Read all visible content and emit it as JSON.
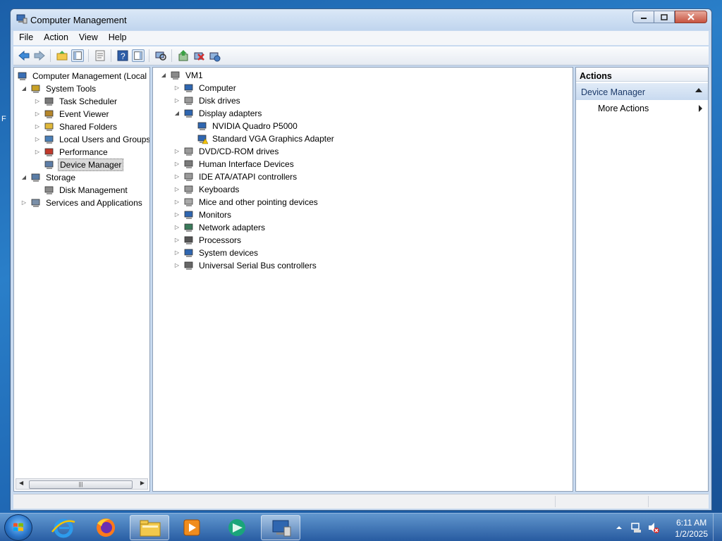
{
  "window": {
    "title": "Computer Management"
  },
  "menu": [
    "File",
    "Action",
    "View",
    "Help"
  ],
  "left_tree": [
    {
      "label": "Computer Management (Local",
      "icon": "computer-management-icon",
      "expander": "",
      "indent": 0
    },
    {
      "label": "System Tools",
      "icon": "system-tools-icon",
      "expander": "expanded",
      "indent": 1
    },
    {
      "label": "Task Scheduler",
      "icon": "clock-icon",
      "expander": "collapsed",
      "indent": 2
    },
    {
      "label": "Event Viewer",
      "icon": "event-viewer-icon",
      "expander": "collapsed",
      "indent": 2
    },
    {
      "label": "Shared Folders",
      "icon": "shared-folders-icon",
      "expander": "collapsed",
      "indent": 2
    },
    {
      "label": "Local Users and Groups",
      "icon": "users-icon",
      "expander": "collapsed",
      "indent": 2
    },
    {
      "label": "Performance",
      "icon": "performance-icon",
      "expander": "collapsed",
      "indent": 2
    },
    {
      "label": "Device Manager",
      "icon": "device-manager-icon",
      "expander": "",
      "indent": 2,
      "selected": true
    },
    {
      "label": "Storage",
      "icon": "storage-icon",
      "expander": "expanded",
      "indent": 1
    },
    {
      "label": "Disk Management",
      "icon": "disk-management-icon",
      "expander": "",
      "indent": 2
    },
    {
      "label": "Services and Applications",
      "icon": "services-icon",
      "expander": "collapsed",
      "indent": 1
    }
  ],
  "device_tree": [
    {
      "label": "VM1",
      "icon": "computer-icon",
      "expander": "expanded",
      "indent": 0
    },
    {
      "label": "Computer",
      "icon": "monitor-icon",
      "expander": "collapsed",
      "indent": 1
    },
    {
      "label": "Disk drives",
      "icon": "disk-drive-icon",
      "expander": "collapsed",
      "indent": 1
    },
    {
      "label": "Display adapters",
      "icon": "display-adapter-icon",
      "expander": "expanded",
      "indent": 1
    },
    {
      "label": "NVIDIA Quadro P5000",
      "icon": "display-adapter-icon",
      "expander": "",
      "indent": 2
    },
    {
      "label": "Standard VGA Graphics Adapter",
      "icon": "display-adapter-warning-icon",
      "expander": "",
      "indent": 2
    },
    {
      "label": "DVD/CD-ROM drives",
      "icon": "dvd-drive-icon",
      "expander": "collapsed",
      "indent": 1
    },
    {
      "label": "Human Interface Devices",
      "icon": "hid-icon",
      "expander": "collapsed",
      "indent": 1
    },
    {
      "label": "IDE ATA/ATAPI controllers",
      "icon": "ide-controller-icon",
      "expander": "collapsed",
      "indent": 1
    },
    {
      "label": "Keyboards",
      "icon": "keyboard-icon",
      "expander": "collapsed",
      "indent": 1
    },
    {
      "label": "Mice and other pointing devices",
      "icon": "mouse-icon",
      "expander": "collapsed",
      "indent": 1
    },
    {
      "label": "Monitors",
      "icon": "monitor-icon",
      "expander": "collapsed",
      "indent": 1
    },
    {
      "label": "Network adapters",
      "icon": "network-adapter-icon",
      "expander": "collapsed",
      "indent": 1
    },
    {
      "label": "Processors",
      "icon": "processor-icon",
      "expander": "collapsed",
      "indent": 1
    },
    {
      "label": "System devices",
      "icon": "system-devices-icon",
      "expander": "collapsed",
      "indent": 1
    },
    {
      "label": "Universal Serial Bus controllers",
      "icon": "usb-icon",
      "expander": "collapsed",
      "indent": 1
    }
  ],
  "actions": {
    "header": "Actions",
    "section": "Device Manager",
    "item": "More Actions"
  },
  "toolbar": [
    "back-arrow-icon",
    "forward-arrow-icon",
    "up-folder-icon",
    "show-hide-console-tree-icon",
    "properties-icon",
    "help-icon",
    "show-hide-action-pane-icon",
    "scan-hardware-icon",
    "update-driver-icon",
    "uninstall-device-icon",
    "enable-device-icon"
  ],
  "taskbar": {
    "time": "6:11 AM",
    "date": "1/2/2025",
    "apps": [
      "internet-explorer-icon",
      "firefox-icon",
      "file-explorer-icon",
      "media-player-icon",
      "app-icon",
      "computer-management-task-icon"
    ]
  }
}
